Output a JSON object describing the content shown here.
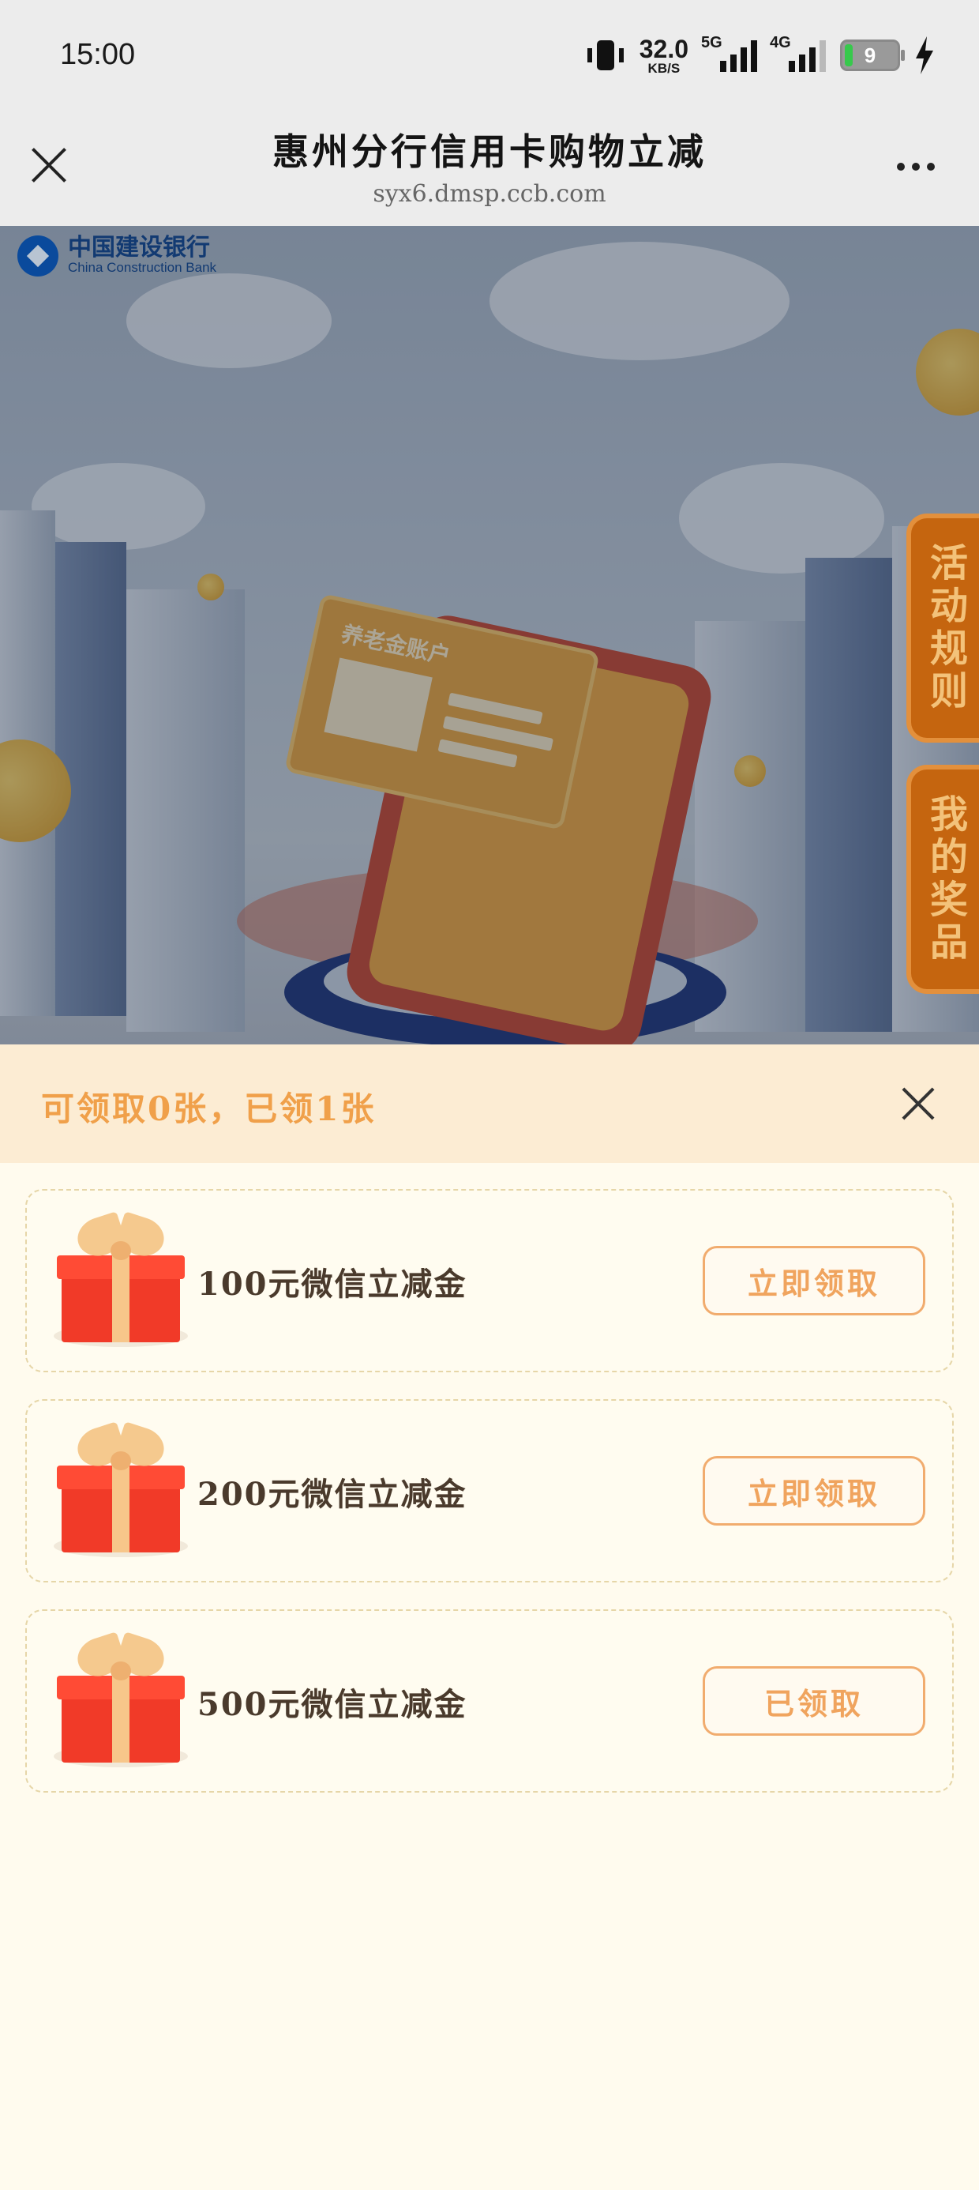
{
  "status_bar": {
    "time": "15:00",
    "speed_value": "32.0",
    "speed_unit": "KB/S",
    "network_5g": "5G",
    "network_4g": "4G",
    "battery_level": "9"
  },
  "header": {
    "title": "惠州分行信用卡购物立减",
    "url": "syx6.dmsp.ccb.com"
  },
  "banner": {
    "logo_cn": "中国建设银行",
    "logo_en": "China Construction Bank",
    "card_text": "养老金账户",
    "side_tabs": [
      "活动规则",
      "我的奖品"
    ]
  },
  "notice": {
    "text": "可领取0张，已领1张"
  },
  "coupons": [
    {
      "name": "100元微信立减金",
      "button": "立即领取"
    },
    {
      "name": "200元微信立减金",
      "button": "立即领取"
    },
    {
      "name": "500元微信立减金",
      "button": "已领取"
    }
  ],
  "colors": {
    "accent": "#f0a04a",
    "notice_bg": "#fcecd3",
    "page_bg": "#fffbee",
    "side_tab": "#c5650f"
  }
}
